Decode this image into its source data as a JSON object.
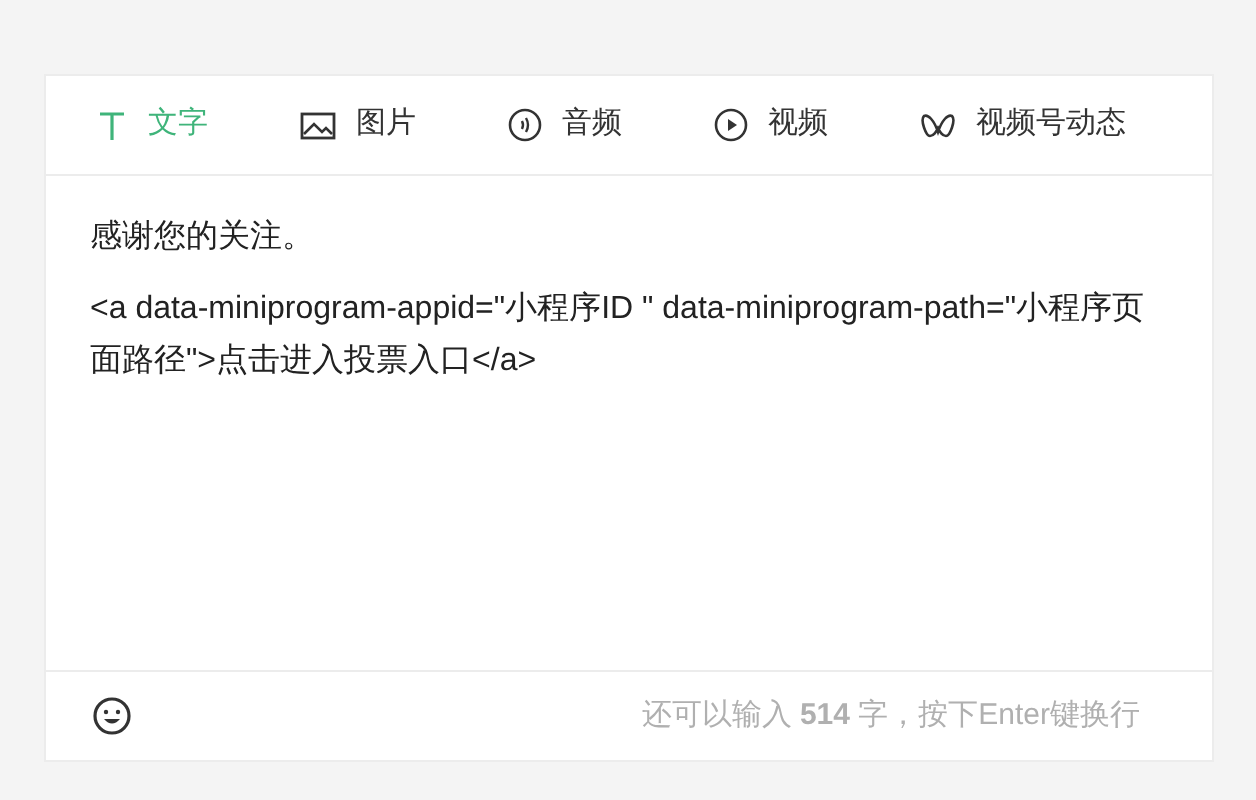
{
  "tabs": [
    {
      "kind": "text",
      "label": "文字",
      "selected": true
    },
    {
      "kind": "image",
      "label": "图片",
      "selected": false
    },
    {
      "kind": "audio",
      "label": "音频",
      "selected": false
    },
    {
      "kind": "video",
      "label": "视频",
      "selected": false
    },
    {
      "kind": "channel",
      "label": "视频号动态",
      "selected": false
    }
  ],
  "content": [
    "感谢您的关注。",
    "<a data-miniprogram-appid=\"小程序ID \" data-miniprogram-path=\"小程序页面路径\">点击进入投票入口</a>"
  ],
  "footer": {
    "hint": "还可以输入 **514** 字，按下Enter键换行"
  }
}
